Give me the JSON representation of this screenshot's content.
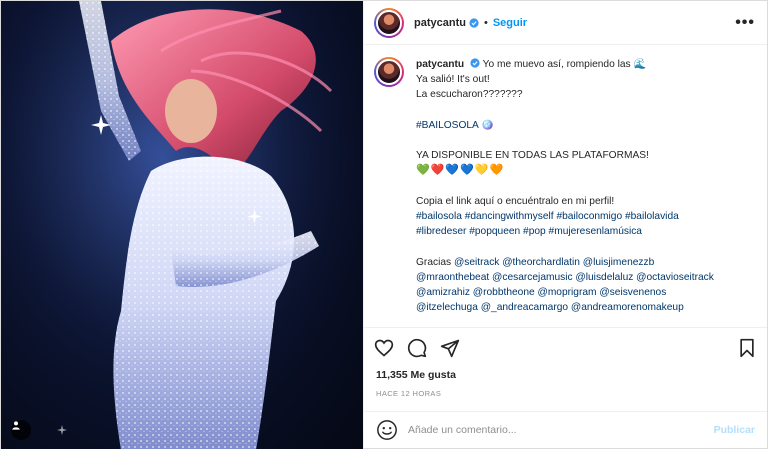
{
  "header": {
    "username": "patycantu",
    "separator": "•",
    "follow_label": "Seguir",
    "more_label": "•••"
  },
  "caption": {
    "username": "patycantu",
    "line1": "Yo me muevo así, rompiendo las 🌊",
    "line2": "Ya salió! It's out!",
    "line3": "La escucharon???????",
    "line4": "#BAILOSOLA 🪩",
    "line5": "YA DISPONIBLE EN TODAS LAS PLATAFORMAS!",
    "hearts": [
      "💚",
      "❤️",
      "💙",
      "💙",
      "💛",
      "🧡"
    ],
    "line6": "Copia el link aquí o encuéntralo en mi perfil!",
    "tags1": "#bailosola #dancingwithmyself #bailoconmigo #bailolavida",
    "tags2": "#libredeser #popqueen #pop #mujeresenlamúsica",
    "line7_prefix": "Gracias ",
    "mentions1": "@seitrack @theorchardlatin @luisjimenezzb",
    "mentions2": "@mraonthebeat @cesarcejamusic @luisdelaluz @octavioseitrack",
    "mentions3": "@amizrahiz @robbtheone @moprigram @seisvenenos",
    "mentions4": "@itzelechuga @_andreacamargo @andreamorenomakeup"
  },
  "stats": {
    "likes": "11,355 Me gusta",
    "time": "HACE 12 HORAS"
  },
  "comment": {
    "placeholder": "Añade un comentario...",
    "publish_label": "Publicar"
  },
  "icons": {
    "like": "heart-icon",
    "comment": "comment-icon",
    "share": "share-icon",
    "save": "bookmark-icon",
    "emoji": "emoji-icon",
    "tag": "user-tag-icon",
    "verified": "verified-badge-icon"
  },
  "colors": {
    "link_blue": "#0095f6",
    "publish_disabled": "#b2dffc",
    "hashtag": "#00376b",
    "muted": "#8e8e8e"
  }
}
